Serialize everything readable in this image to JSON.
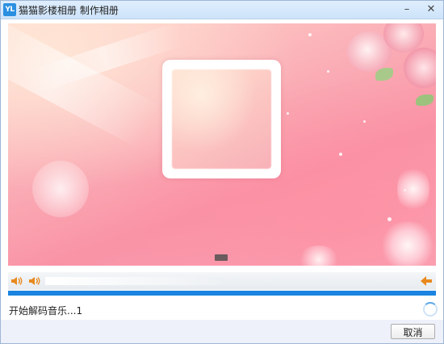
{
  "window": {
    "icon_text": "YL",
    "title": "猫猫影楼相册 制作相册",
    "minimize_glyph": "–",
    "close_glyph": "✕"
  },
  "preview": {
    "background": "pink-roses-theme",
    "card_color": "#ffffff"
  },
  "controls": {
    "volume_icon": "speaker-icon",
    "back_icon": "arrow-left-icon",
    "accent_color": "#e8891f"
  },
  "progress": {
    "fraction": 1.0,
    "color": "#1a84e0"
  },
  "status": {
    "text": "开始解码音乐...1",
    "spinner_icon": "loading-spinner-icon"
  },
  "footer": {
    "cancel_label": "取消"
  }
}
